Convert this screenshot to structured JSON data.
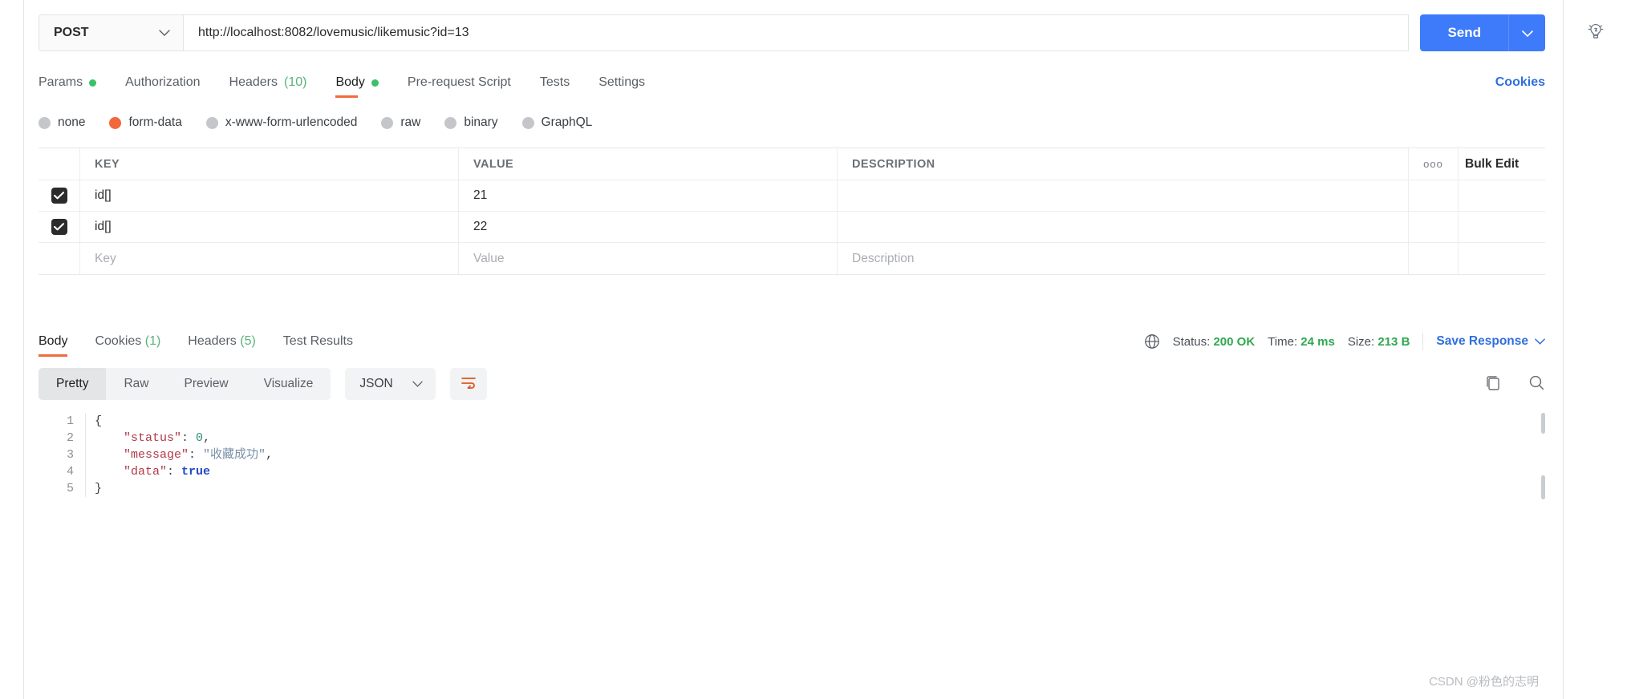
{
  "request": {
    "method": "POST",
    "url": "http://localhost:8082/lovemusic/likemusic?id=13",
    "send_label": "Send",
    "tabs": [
      {
        "label": "Params",
        "dot": true
      },
      {
        "label": "Authorization",
        "dot": false
      },
      {
        "label": "Headers",
        "count": "(10)"
      },
      {
        "label": "Body",
        "dot": true,
        "active": true
      },
      {
        "label": "Pre-request Script",
        "dot": false
      },
      {
        "label": "Tests",
        "dot": false
      },
      {
        "label": "Settings",
        "dot": false
      }
    ],
    "cookies_link": "Cookies",
    "body_types": [
      {
        "label": "none",
        "selected": false
      },
      {
        "label": "form-data",
        "selected": true
      },
      {
        "label": "x-www-form-urlencoded",
        "selected": false
      },
      {
        "label": "raw",
        "selected": false
      },
      {
        "label": "binary",
        "selected": false
      },
      {
        "label": "GraphQL",
        "selected": false
      }
    ],
    "table": {
      "headers": {
        "key": "KEY",
        "value": "VALUE",
        "description": "DESCRIPTION"
      },
      "dots_icon": "ooo",
      "bulk_edit": "Bulk Edit",
      "rows": [
        {
          "checked": true,
          "key": "id[]",
          "value": "21",
          "description": ""
        },
        {
          "checked": true,
          "key": "id[]",
          "value": "22",
          "description": ""
        }
      ],
      "placeholder_row": {
        "key": "Key",
        "value": "Value",
        "description": "Description"
      }
    }
  },
  "response": {
    "tabs": [
      {
        "label": "Body",
        "active": true
      },
      {
        "label": "Cookies",
        "count": "(1)"
      },
      {
        "label": "Headers",
        "count": "(5)"
      },
      {
        "label": "Test Results"
      }
    ],
    "meta": {
      "status_label": "Status:",
      "status_value": "200 OK",
      "time_label": "Time:",
      "time_value": "24 ms",
      "size_label": "Size:",
      "size_value": "213 B",
      "save_response": "Save Response"
    },
    "view_modes": [
      {
        "label": "Pretty",
        "active": true
      },
      {
        "label": "Raw",
        "active": false
      },
      {
        "label": "Preview",
        "active": false
      },
      {
        "label": "Visualize",
        "active": false
      }
    ],
    "format": "JSON",
    "code": {
      "line_numbers": [
        "1",
        "2",
        "3",
        "4",
        "5"
      ],
      "lines": [
        {
          "segments": [
            {
              "t": "{",
              "c": "p"
            }
          ]
        },
        {
          "segments": [
            {
              "t": "    ",
              "c": "p"
            },
            {
              "t": "\"status\"",
              "c": "k"
            },
            {
              "t": ": ",
              "c": "p"
            },
            {
              "t": "0",
              "c": "n"
            },
            {
              "t": ",",
              "c": "p"
            }
          ]
        },
        {
          "segments": [
            {
              "t": "    ",
              "c": "p"
            },
            {
              "t": "\"message\"",
              "c": "k"
            },
            {
              "t": ": ",
              "c": "p"
            },
            {
              "t": "\"收藏成功\"",
              "c": "s"
            },
            {
              "t": ",",
              "c": "p"
            }
          ]
        },
        {
          "segments": [
            {
              "t": "    ",
              "c": "p"
            },
            {
              "t": "\"data\"",
              "c": "k"
            },
            {
              "t": ": ",
              "c": "p"
            },
            {
              "t": "true",
              "c": "b"
            }
          ]
        },
        {
          "segments": [
            {
              "t": "}",
              "c": "p"
            }
          ]
        }
      ]
    }
  },
  "watermark": "CSDN @粉色的志明",
  "colors": {
    "accent_orange": "#f26b3a",
    "send_blue": "#3e7bfa",
    "link_blue": "#2f6fdd",
    "status_green": "#2fa84f"
  }
}
